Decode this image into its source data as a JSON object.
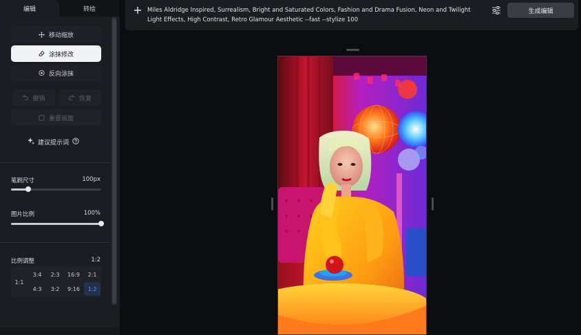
{
  "tabs": {
    "edit": "编辑",
    "transfer": "转绘"
  },
  "tools": {
    "move_zoom": "移动缩放",
    "erase_edit": "涂抹修改",
    "reverse_erase": "反向涂抹",
    "undo": "撤销",
    "redo": "恢复",
    "reset_canvas": "重置画面",
    "suggest_prompt": "建议提示词"
  },
  "brush_size": {
    "label": "笔刷尺寸",
    "value": "100px",
    "level": 0.19
  },
  "image_ratio": {
    "label": "图片比例",
    "value": "100%",
    "level": 1.0
  },
  "aspect": {
    "label": "比例调整",
    "current": "1:2",
    "options": [
      "1:1",
      "3:4",
      "2:3",
      "16:9",
      "2:1",
      "4:3",
      "3:2",
      "9:16",
      "1:2"
    ],
    "selected": "1:2"
  },
  "prompt": {
    "text": "Miles Aldridge Inspired, Surrealism, Bright and Saturated Colors, Fashion and Drama Fusion, Neon and Twilight Light Effects, High Contrast, Retro Glamour Aesthetic --fast --stylize 100"
  },
  "generate_label": "生成编辑",
  "icons": {
    "move": "move-arrows-icon",
    "erase": "eraser-icon",
    "reverse": "reverse-target-icon",
    "undo": "undo-icon",
    "redo": "redo-icon",
    "reset": "reset-icon",
    "suggest": "sparkle-icon",
    "help": "help-circle-icon",
    "add": "plus-icon",
    "settings": "sliders-icon"
  },
  "colors": {
    "panel_bg": "#1b1d22",
    "page_bg": "#0c0d10",
    "active_tool_bg": "#f2f3f5",
    "selected_ratio": "#6f8fe0"
  }
}
